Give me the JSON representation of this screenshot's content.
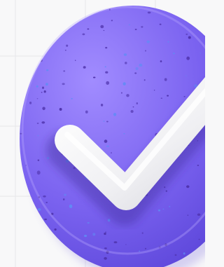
{
  "scene": {
    "subject": "check-badge-illustration",
    "icon": "checkmark-icon",
    "colors": {
      "background": "#f8f8f9",
      "grid_line": "#e9e9ec",
      "badge_base": "#7b63f0",
      "badge_highlight": "#a18cff",
      "badge_shadow": "#5a44d8",
      "speckle_dark": "#4b2fa8",
      "speckle_light": "#5f8cf5",
      "check_mark": "#f4f4f7"
    }
  }
}
